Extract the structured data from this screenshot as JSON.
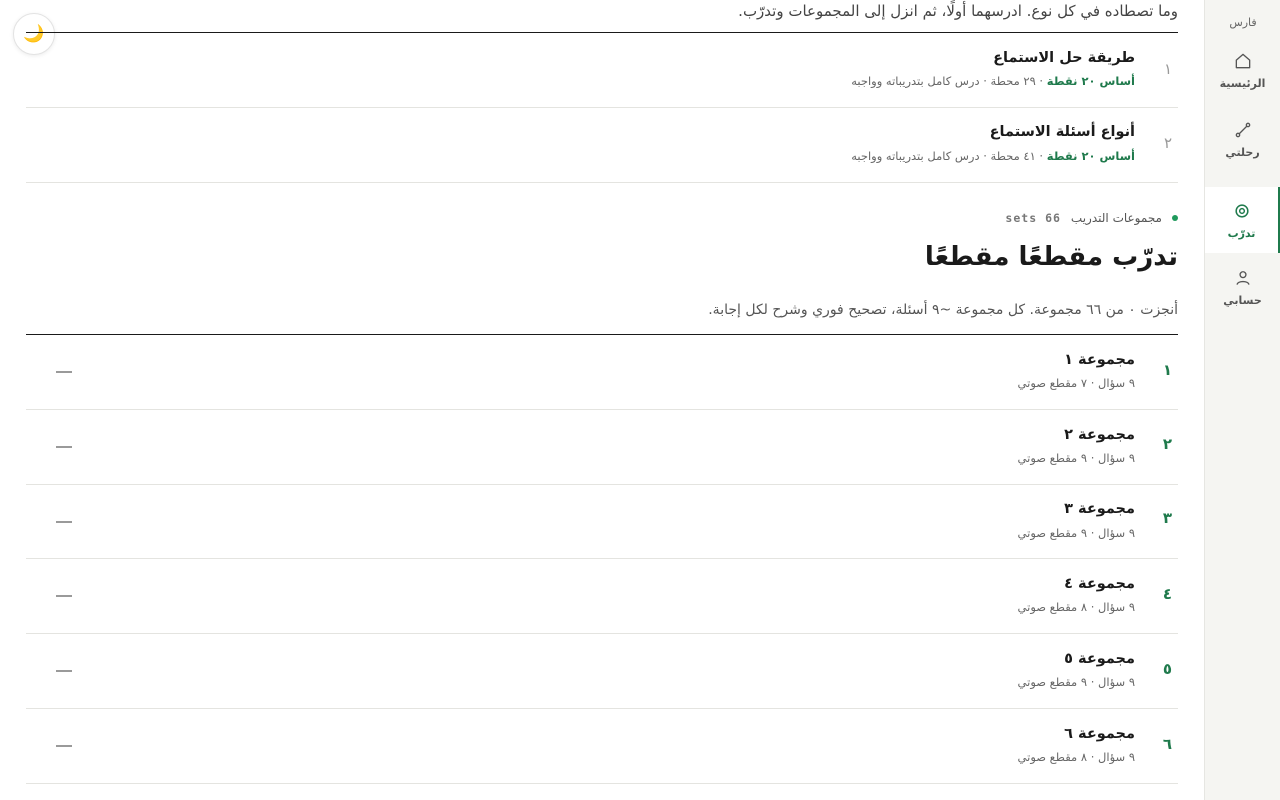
{
  "app": {
    "brand": "فارس"
  },
  "nav": [
    {
      "label": "الرئيسية",
      "icon": "home-icon",
      "active": false
    },
    {
      "label": "رحلتي",
      "icon": "route-icon",
      "active": false
    },
    {
      "label": "تدرّب",
      "icon": "target-icon",
      "active": true
    },
    {
      "label": "حسابي",
      "icon": "user-icon",
      "active": false
    }
  ],
  "theme_toggle": {
    "glyph": "🌙"
  },
  "intro": {
    "tail_text": "وما تصطاده في كل نوع. ادرسهما أولًا، ثم انزل إلى المجموعات وتدرّب."
  },
  "lessons": [
    {
      "num": "١",
      "title": "طريقة حل الاستماع",
      "tag": "أساس ٢٠ نقطة",
      "details": " · ٢٩ محطة · درس كامل بتدريباته وواجبه"
    },
    {
      "num": "٢",
      "title": "أنواع أسئلة الاستماع",
      "tag": "أساس ٢٠ نقطة",
      "details": " · ٤١ محطة · درس كامل بتدريباته وواجبه"
    }
  ],
  "practice": {
    "section_label": "مجموعات التدريب",
    "section_count": "66 sets",
    "title": "تدرّب مقطعًا مقطعًا",
    "subtitle": "أنجزت ٠ من ٦٦ مجموعة. كل مجموعة ~٩ أسئلة، تصحيح فوري وشرح لكل إجابة.",
    "status_placeholder": "—"
  },
  "sets": [
    {
      "num": "١",
      "title": "مجموعة ١",
      "meta": "٩ سؤال · ٧ مقطع صوتي"
    },
    {
      "num": "٢",
      "title": "مجموعة ٢",
      "meta": "٩ سؤال · ٩ مقطع صوتي"
    },
    {
      "num": "٣",
      "title": "مجموعة ٣",
      "meta": "٩ سؤال · ٩ مقطع صوتي"
    },
    {
      "num": "٤",
      "title": "مجموعة ٤",
      "meta": "٩ سؤال · ٨ مقطع صوتي"
    },
    {
      "num": "٥",
      "title": "مجموعة ٥",
      "meta": "٩ سؤال · ٩ مقطع صوتي"
    },
    {
      "num": "٦",
      "title": "مجموعة ٦",
      "meta": "٩ سؤال · ٨ مقطع صوتي"
    }
  ],
  "colors": {
    "accent": "#1f7a4c",
    "sidebar_bg": "#f5f5f2"
  }
}
